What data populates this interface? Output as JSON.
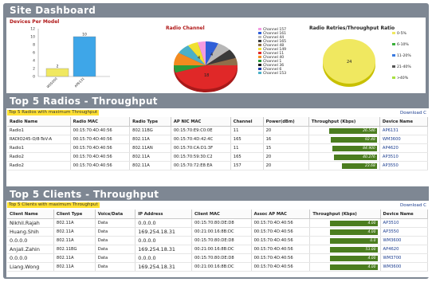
{
  "header": {
    "title": "Site Dashboard"
  },
  "devices_chart": {
    "title": "Devices Per Model",
    "ylim": [
      0,
      12
    ],
    "yticks": [
      "12",
      "10",
      "8",
      "6",
      "4",
      "2",
      "0"
    ],
    "categories": [
      "WS5000",
      "AP6131"
    ],
    "values": [
      2,
      10
    ],
    "value_labels": [
      "2",
      "10"
    ],
    "colors": [
      "#f0e860",
      "#3ea6e8"
    ]
  },
  "radio_channel": {
    "title": "Radio Channel",
    "slice_labels": [
      "4",
      "4",
      "18"
    ],
    "legend": [
      {
        "label": "Channel 157",
        "color": "#f39be0"
      },
      {
        "label": "Channel 161",
        "color": "#2f5fd8"
      },
      {
        "label": "Channel 44",
        "color": "#b7b7b7"
      },
      {
        "label": "Channel 165",
        "color": "#3a3a3a"
      },
      {
        "label": "Channel 48",
        "color": "#8f6f4a"
      },
      {
        "label": "Channel 149",
        "color": "#f0e030"
      },
      {
        "label": "Channel 11",
        "color": "#e02828"
      },
      {
        "label": "Channel 40",
        "color": "#f28a1f"
      },
      {
        "label": "Channel 1",
        "color": "#2a9a3a"
      },
      {
        "label": "Channel 36",
        "color": "#1a1a1a"
      },
      {
        "label": "Channel 6",
        "color": "#1e3aa8"
      },
      {
        "label": "Channel 153",
        "color": "#4ab0c8"
      }
    ]
  },
  "retries_chart": {
    "title": "Radio Retries/Throughput Ratio",
    "slice_label": "24",
    "legend": [
      {
        "label": "0-5%",
        "color": "#f0e860"
      },
      {
        "label": "6-10%",
        "color": "#3ab03a"
      },
      {
        "label": "11-20%",
        "color": "#3a7ae0"
      },
      {
        "label": "21-40%",
        "color": "#555555"
      },
      {
        "label": ">40%",
        "color": "#a8e040"
      }
    ]
  },
  "top_radios": {
    "section_title": "Top 5 Radios - Throughput",
    "subtitle": "Top 5 Radios with maximum Throughput",
    "download": "Download C",
    "columns": [
      "Radio Name",
      "Radio MAC",
      "Radio Type",
      "AP NIC MAC",
      "Channel",
      "Power(dBm)",
      "Throughput (Kbps)",
      "Device Name"
    ],
    "rows": [
      {
        "name": "Radio1",
        "mac": "00:15:70:4D:40:56",
        "type": "802.11BG",
        "nic": "00:15:70:E9:C0:0E",
        "channel": "11",
        "power": "20",
        "tp": "26.546",
        "tp_frac": 1.0,
        "device": "AP6131"
      },
      {
        "name": "RADIO245-O/8-TeV-A",
        "mac": "00:15:70:4D:40:56",
        "type": "802.11A",
        "nic": "00:15:70:4D:42:4C",
        "channel": "165",
        "power": "16",
        "tp": "92.48",
        "tp_frac": 0.97,
        "device": "WM3600"
      },
      {
        "name": "Radio1",
        "mac": "00:15:70:4D:40:56",
        "type": "802.11AN",
        "nic": "00:15:70:CA:D1:3F",
        "channel": "11",
        "power": "15",
        "tp": "84.900",
        "tp_frac": 0.93,
        "device": "AP4620"
      },
      {
        "name": "Radio2",
        "mac": "00:15:70:4D:40:56",
        "type": "802.11A",
        "nic": "00:15:70:59:30:C2",
        "channel": "165",
        "power": "20",
        "tp": "40.276",
        "tp_frac": 0.9,
        "device": "AP3510"
      },
      {
        "name": "Radio2",
        "mac": "00:15:70:4D:40:56",
        "type": "802.11A",
        "nic": "00:15:70:72:E8:EA",
        "channel": "157",
        "power": "20",
        "tp": "23.68",
        "tp_frac": 0.72,
        "device": "AP3550"
      }
    ]
  },
  "top_clients": {
    "section_title": "Top 5 Clients - Throughput",
    "subtitle": "Top 5 Clients with maximum Throughput",
    "download": "Download C",
    "columns": [
      "Client Name",
      "Client Type",
      "Voice/Data",
      "IP Address",
      "Client MAC",
      "Assoc AP MAC",
      "Throughput (Kbps)",
      "Device Name"
    ],
    "rows": [
      {
        "name": "Nikhil.Rajah",
        "type": "802.11A",
        "vd": "Data",
        "ip": "0.0.0.0",
        "mac": "00:15:70:80:DE:D8",
        "ap": "00:15:70:4D:40:56",
        "tp": "4.00",
        "tp_frac": 1.0,
        "device": "AP3510"
      },
      {
        "name": "Huang.Shih",
        "type": "802.11A",
        "vd": "Data",
        "ip": "169.254.18.31",
        "mac": "00:21:00:16:8B:DC",
        "ap": "00:15:70:4D:40:56",
        "tp": "4.00",
        "tp_frac": 1.0,
        "device": "AP3550"
      },
      {
        "name": "0.0.0.0",
        "type": "802.11A",
        "vd": "Data",
        "ip": "0.0.0.0",
        "mac": "00:15:70:80:DE:D8",
        "ap": "00:15:70:4D:40:56",
        "tp": "0.0",
        "tp_frac": 1.0,
        "device": "WM3600"
      },
      {
        "name": "Anjali.Zahin",
        "type": "802.11BG",
        "vd": "Data",
        "ip": "169.254.18.31",
        "mac": "00:21:00:16:8B:DC",
        "ap": "00:15:70:4D:40:56",
        "tp": "53.00",
        "tp_frac": 1.0,
        "device": "AP4620"
      },
      {
        "name": "0.0.0.0",
        "type": "802.11A",
        "vd": "Data",
        "ip": "0.0.0.0",
        "mac": "00:15:70:80:DE:D8",
        "ap": "00:15:70:4D:40:56",
        "tp": "4.00",
        "tp_frac": 1.0,
        "device": "WM3700"
      },
      {
        "name": "Liang.Wong",
        "type": "802.11A",
        "vd": "Data",
        "ip": "169.254.18.31",
        "mac": "00:21:00:16:8B:DC",
        "ap": "00:15:70:4D:40:56",
        "tp": "4.00",
        "tp_frac": 1.0,
        "device": "WM3600"
      }
    ]
  }
}
